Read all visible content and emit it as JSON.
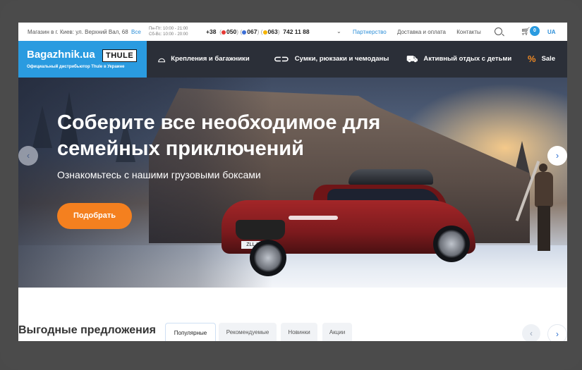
{
  "topbar": {
    "address": "Магазин в г. Киев: ул. Верхний Вал, 68",
    "all_link": "Все",
    "hours_weekday": "Пн-Пт: 10:00 - 21:00",
    "hours_weekend": "Сб-Вс: 10:00 - 20:00",
    "phone_prefix": "+38",
    "operator_1": "050",
    "operator_2": "067",
    "operator_3": "063",
    "phone_number": "742 11 88",
    "links": [
      "Партнерство",
      "Доставка и оплата",
      "Контакты"
    ],
    "cart_count": "0",
    "language": "UA",
    "colors": {
      "accent": "#2a9be0",
      "op1": "#e53935",
      "op2": "#3d6fd6",
      "op3": "#f5b400"
    }
  },
  "logo": {
    "brand": "Bagazhnik.ua",
    "partner": "THULE",
    "tagline": "Официальный дистрибьютор Thule в Украине"
  },
  "nav": {
    "items": [
      {
        "label": "Крепления и багажники",
        "icon": "roof-box-icon"
      },
      {
        "label": "Сумки, рюкзаки и чемоданы",
        "icon": "bag-icon"
      },
      {
        "label": "Активный отдых с детьми",
        "icon": "stroller-icon"
      },
      {
        "label": "Sale",
        "icon": "percent-icon"
      }
    ]
  },
  "hero": {
    "title": "Соберите все необходимое для семейных приключений",
    "subtitle": "Ознакомьтесь с нашими грузовыми боксами",
    "cta": "Подобрать",
    "plate": "ZLL 354",
    "colors": {
      "cta": "#f4801f"
    }
  },
  "offers": {
    "title": "Выгодные предложения",
    "tabs": [
      "Популярные",
      "Рекомендуемые",
      "Новинки",
      "Акции"
    ],
    "active_tab": "Популярные"
  }
}
